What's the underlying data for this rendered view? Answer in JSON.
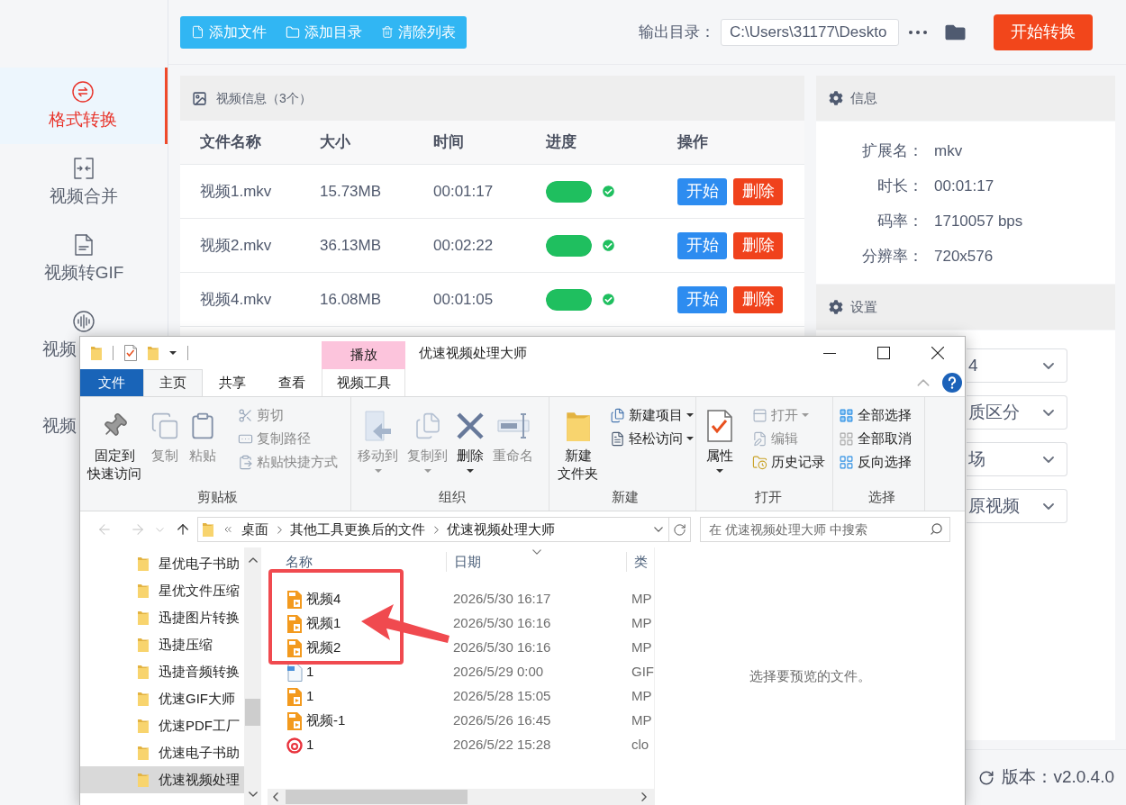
{
  "sidebar": {
    "items": [
      {
        "label": "格式转换",
        "selected": true
      },
      {
        "label": "视频合并",
        "selected": false
      },
      {
        "label": "视频转GIF",
        "selected": false
      },
      {
        "label": "视频",
        "selected": false,
        "clipped": true
      },
      {
        "label": "视频",
        "selected": false,
        "clipped": true
      }
    ]
  },
  "toolbar": {
    "buttons": [
      "添加文件",
      "添加目录",
      "清除列表"
    ],
    "output_label": "输出目录：",
    "output_path": "C:\\Users\\31177\\Deskto",
    "start_button": "开始转换"
  },
  "video_list": {
    "title": "视频信息（3个）",
    "columns": [
      "文件名称",
      "大小",
      "时间",
      "进度",
      "操作"
    ],
    "rows": [
      {
        "name": "视频1.mkv",
        "size": "15.73MB",
        "time": "00:01:17",
        "level": 1,
        "done": true,
        "actions": [
          {
            "label": "开始",
            "kind": "start"
          },
          {
            "label": "删除",
            "kind": "delete"
          }
        ]
      },
      {
        "name": "视频2.mkv",
        "size": "36.13MB",
        "time": "00:02:22",
        "level": 1,
        "done": true,
        "actions": [
          {
            "label": "开始",
            "kind": "start"
          },
          {
            "label": "删除",
            "kind": "delete"
          }
        ]
      },
      {
        "name": "视频4.mkv",
        "size": "16.08MB",
        "time": "00:01:05",
        "level": 1,
        "done": true,
        "actions": [
          {
            "label": "开始",
            "kind": "start"
          },
          {
            "label": "删除",
            "kind": "delete"
          }
        ]
      }
    ]
  },
  "info": {
    "title": "信息",
    "fields": [
      {
        "label": "扩展名：",
        "value": "mkv"
      },
      {
        "label": "时长：",
        "value": "00:01:17"
      },
      {
        "label": "码率：",
        "value": "1710057 bps"
      },
      {
        "label": "分辨率：",
        "value": "720x576"
      }
    ]
  },
  "settings": {
    "title": "设置",
    "selects": [
      "4",
      "质区分",
      "场",
      "原视频"
    ]
  },
  "footer": {
    "version": "版本：v2.0.4.0"
  },
  "explorer": {
    "title": "优速视频处理大师",
    "context_group": "播放",
    "tabs": [
      {
        "label": "文件",
        "kind": "file",
        "selected": false
      },
      {
        "label": "主页",
        "kind": "tab",
        "selected": true
      },
      {
        "label": "共享",
        "kind": "tab",
        "selected": false
      },
      {
        "label": "查看",
        "kind": "tab",
        "selected": false
      },
      {
        "label": "视频工具",
        "kind": "context",
        "selected": false
      }
    ],
    "ribbon_groups": [
      {
        "label": "剪贴板",
        "large": [
          {
            "lines": [
              "固定到",
              "快速访问"
            ],
            "disabled": false
          },
          {
            "lines": [
              "复制"
            ],
            "disabled": true
          },
          {
            "lines": [
              "粘贴"
            ],
            "disabled": true
          }
        ],
        "small": [
          {
            "label": "剪切",
            "disabled": true
          },
          {
            "label": "复制路径",
            "disabled": true
          },
          {
            "label": "粘贴快捷方式",
            "disabled": true
          }
        ]
      },
      {
        "label": "组织",
        "large": [
          {
            "lines": [
              "移动到"
            ],
            "disabled": true,
            "menu": true
          },
          {
            "lines": [
              "复制到"
            ],
            "disabled": true,
            "menu": true
          },
          {
            "lines": [
              "删除"
            ],
            "disabled": false,
            "menu": true
          },
          {
            "lines": [
              "重命名"
            ],
            "disabled": true
          }
        ]
      },
      {
        "label": "新建",
        "large": [
          {
            "lines": [
              "新建",
              "文件夹"
            ],
            "disabled": false
          }
        ],
        "small": [
          {
            "label": "新建项目",
            "disabled": false,
            "menu": true
          },
          {
            "label": "轻松访问",
            "disabled": false,
            "menu": true
          }
        ]
      },
      {
        "label": "打开",
        "large": [
          {
            "lines": [
              "属性"
            ],
            "disabled": false,
            "menu": true
          }
        ],
        "small": [
          {
            "label": "打开",
            "disabled": true,
            "menu": true
          },
          {
            "label": "编辑",
            "disabled": true
          },
          {
            "label": "历史记录",
            "disabled": false
          }
        ]
      },
      {
        "label": "选择",
        "small": [
          {
            "label": "全部选择",
            "disabled": false
          },
          {
            "label": "全部取消",
            "disabled": false
          },
          {
            "label": "反向选择",
            "disabled": false
          }
        ]
      }
    ],
    "path": [
      "桌面",
      "其他工具更换后的文件",
      "优速视频处理大师"
    ],
    "search_placeholder": "在 优速视频处理大师 中搜索",
    "nav_items": [
      {
        "label": "星优电子书助",
        "selected": false
      },
      {
        "label": "星优文件压缩",
        "selected": false
      },
      {
        "label": "迅捷图片转换",
        "selected": false
      },
      {
        "label": "迅捷压缩",
        "selected": false
      },
      {
        "label": "迅捷音频转换",
        "selected": false
      },
      {
        "label": "优速GIF大师",
        "selected": false
      },
      {
        "label": "优速PDF工厂",
        "selected": false
      },
      {
        "label": "优速电子书助",
        "selected": false
      },
      {
        "label": "优速视频处理",
        "selected": true
      }
    ],
    "columns": [
      "名称",
      "日期",
      "类"
    ],
    "files": [
      {
        "name": "视频4",
        "date": "2026/5/30 16:17",
        "type": "MP",
        "kind": "video"
      },
      {
        "name": "视频1",
        "date": "2026/5/30 16:16",
        "type": "MP",
        "kind": "video"
      },
      {
        "name": "视频2",
        "date": "2026/5/30 16:16",
        "type": "MP",
        "kind": "video"
      },
      {
        "name": "1",
        "date": "2026/5/29 0:00",
        "type": "GIF",
        "kind": "gif"
      },
      {
        "name": "1",
        "date": "2026/5/28 15:05",
        "type": "MP",
        "kind": "video"
      },
      {
        "name": "视频-1",
        "date": "2026/5/26 16:45",
        "type": "MP",
        "kind": "video"
      },
      {
        "name": "1",
        "date": "2026/5/22 15:28",
        "type": "clo",
        "kind": "music"
      }
    ],
    "preview_text": "选择要预览的文件。"
  }
}
